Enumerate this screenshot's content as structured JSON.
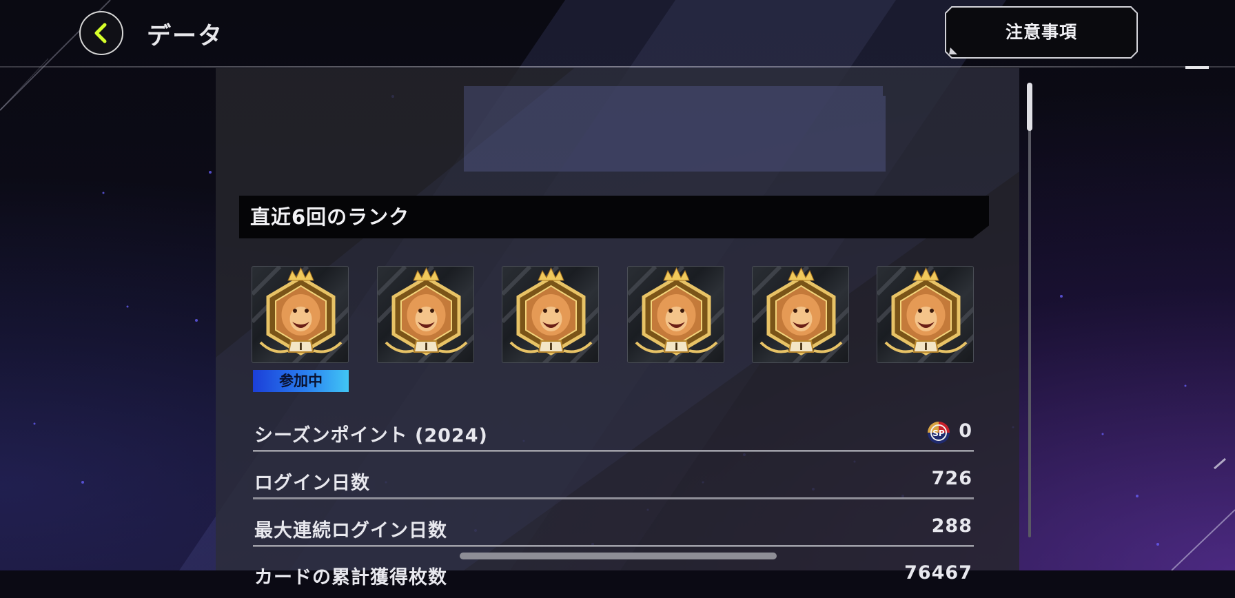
{
  "header": {
    "title": "データ",
    "notes_button_label": "注意事項"
  },
  "rank_section": {
    "heading": "直近6回のランク",
    "ranks": [
      {
        "icon": "lion-rank-emblem-icon",
        "rank_numeral": "I"
      },
      {
        "icon": "lion-rank-emblem-icon",
        "rank_numeral": "I"
      },
      {
        "icon": "lion-rank-emblem-icon",
        "rank_numeral": "I"
      },
      {
        "icon": "lion-rank-emblem-icon",
        "rank_numeral": "I"
      },
      {
        "icon": "lion-rank-emblem-icon",
        "rank_numeral": "I"
      },
      {
        "icon": "lion-rank-emblem-icon",
        "rank_numeral": "I"
      }
    ],
    "current_badge": "参加中"
  },
  "stats": [
    {
      "label": "シーズンポイント (2024)",
      "value": "0",
      "icon": "season-point-icon",
      "icon_text": "SP"
    },
    {
      "label": "ログイン日数",
      "value": "726"
    },
    {
      "label": "最大連続ログイン日数",
      "value": "288"
    },
    {
      "label": "カードの累計獲得枚数",
      "value": "76467"
    }
  ],
  "colors": {
    "accent_yellow": "#d6ff2a",
    "badge_blue": "#2a7ff0",
    "gold": "#d9a441"
  }
}
